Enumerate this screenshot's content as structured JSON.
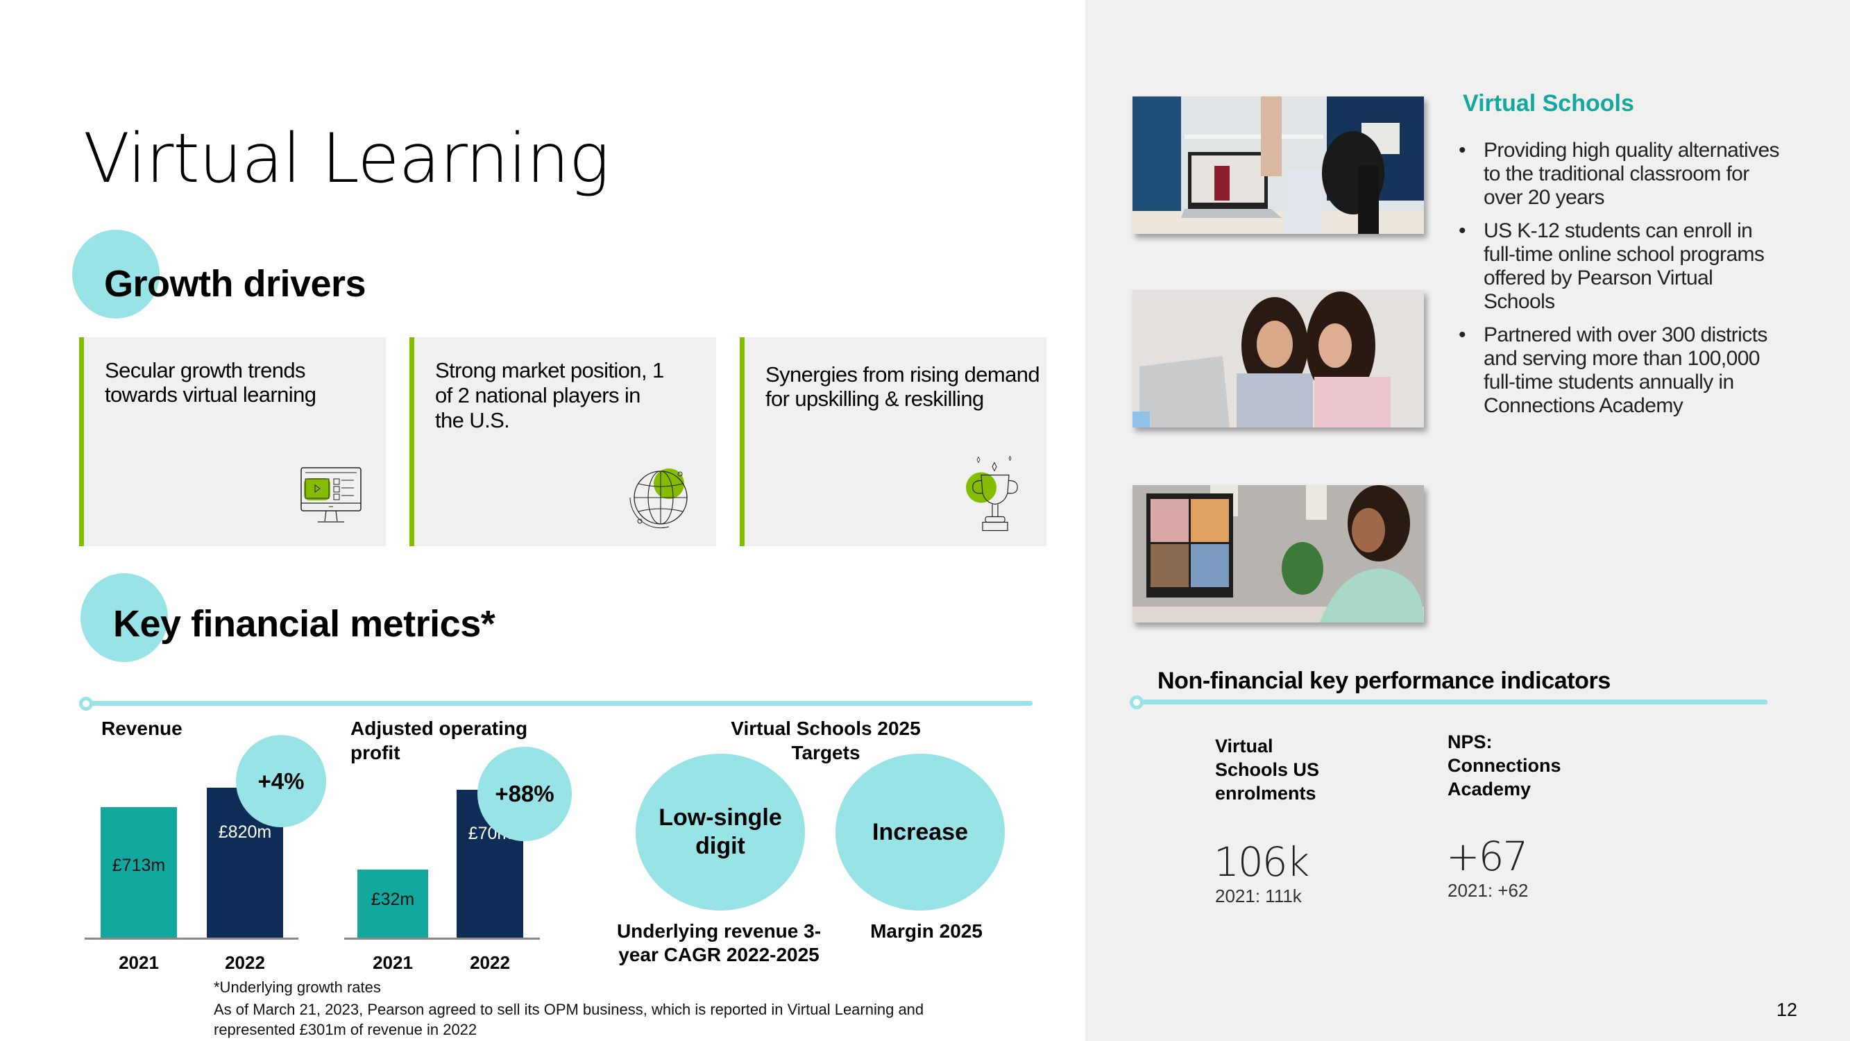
{
  "page": {
    "title": "Virtual Learning",
    "page_number": "12"
  },
  "colors": {
    "accent_cyan": "#98e3e6",
    "accent_green": "#84bd00",
    "teal": "#13a89e",
    "navy": "#0d2d56",
    "panel_bg": "#f0f0f0"
  },
  "growth_drivers": {
    "heading": "Growth drivers",
    "cards": [
      {
        "text": "Secular growth trends towards virtual learning",
        "icon": "monitor-video-icon"
      },
      {
        "text": "Strong market position, 1 of 2 national players in the U.S.",
        "icon": "globe-icon"
      },
      {
        "text": "Synergies from rising demand for upskilling & reskilling",
        "icon": "trophy-icon"
      }
    ]
  },
  "key_financial_metrics": {
    "heading": "Key financial metrics*"
  },
  "chart_data": [
    {
      "type": "bar",
      "title": "Revenue",
      "categories": [
        "2021",
        "2022"
      ],
      "values": [
        713,
        820
      ],
      "value_labels": [
        "£713m",
        "£820m"
      ],
      "unit": "£m",
      "growth_badge": "+4%",
      "bar_colors": [
        "#13a89e",
        "#0d2d56"
      ],
      "ylim": [
        0,
        950
      ]
    },
    {
      "type": "bar",
      "title": "Adjusted operating profit",
      "categories": [
        "2021",
        "2022"
      ],
      "values": [
        32,
        70
      ],
      "value_labels": [
        "£32m",
        "£70m"
      ],
      "unit": "£m",
      "growth_badge": "+88%",
      "bar_colors": [
        "#13a89e",
        "#0d2d56"
      ],
      "ylim": [
        0,
        82
      ]
    }
  ],
  "targets": {
    "heading": "Virtual Schools 2025 Targets",
    "items": [
      {
        "value": "Low-single digit",
        "caption": "Underlying revenue 3-year CAGR 2022-2025"
      },
      {
        "value": "Increase",
        "caption": "Margin 2025"
      }
    ]
  },
  "footnotes": {
    "line1": "*Underlying growth rates",
    "line2": "As of March 21, 2023, Pearson agreed to sell its OPM business, which is reported in Virtual Learning and",
    "line3": "represented £301m of revenue in 2022"
  },
  "virtual_schools": {
    "title": "Virtual Schools",
    "bullets": [
      "Providing high quality alternatives to the traditional classroom for over 20 years",
      "US K-12 students can enroll in full-time online school programs offered by Pearson Virtual Schools",
      "Partnered with over 300 districts and serving more than 100,000 full-time students annually in Connections Academy"
    ],
    "photos": [
      {
        "alt": "Girl raising hand during online class on laptop"
      },
      {
        "alt": "Woman and girl studying together at a laptop"
      },
      {
        "alt": "Teen waving at a video call on a desktop monitor"
      }
    ]
  },
  "kpis": {
    "heading": "Non-financial key performance indicators",
    "items": [
      {
        "label": "Virtual Schools US enrolments",
        "value": "106k",
        "previous": "2021: 111k"
      },
      {
        "label": "NPS: Connections Academy",
        "value": "+67",
        "previous": "2021: +62"
      }
    ]
  }
}
